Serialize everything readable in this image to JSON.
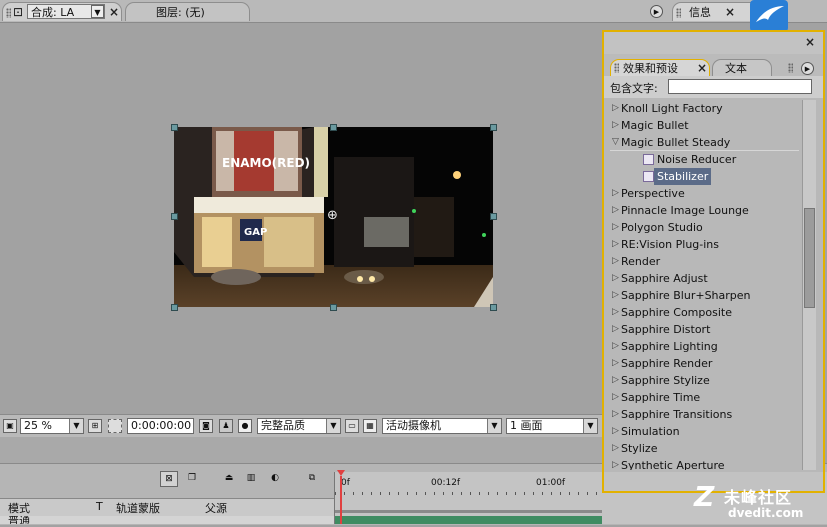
{
  "top_tabs": {
    "comp_tab_label": "合成: LA",
    "layer_tab_label": "图层: (无)",
    "info_tab_label": "信息",
    "close_glyph": "×"
  },
  "comp_timecode_partial": "0:00:00:00",
  "viewer_toolbar": {
    "zoom_value": "25 %",
    "timecode": "0:00:00:00",
    "quality_value": "完整品质",
    "camera_value": "活动摄像机",
    "view_value": "1 画面"
  },
  "timeline": {
    "columns": {
      "mode": "模式",
      "t": "T",
      "track_matte": "轨道蒙版",
      "parent": "父源"
    },
    "row_partial_mode": "普通",
    "ruler_ticks": [
      "0f",
      "00:12f",
      "01:00f"
    ]
  },
  "effects_panel": {
    "tab_effects": "效果和预设",
    "tab_text": "文本",
    "search_label": "包含文字:",
    "search_value": "",
    "items": [
      {
        "label": "Knoll Light Factory",
        "expanded": false,
        "level": 0
      },
      {
        "label": "Magic Bullet",
        "expanded": false,
        "level": 0
      },
      {
        "label": "Magic Bullet Steady",
        "expanded": true,
        "level": 0
      },
      {
        "label": "Noise Reducer",
        "level": 1
      },
      {
        "label": "Stabilizer",
        "level": 1,
        "selected": true
      },
      {
        "label": "Perspective",
        "expanded": false,
        "level": 0
      },
      {
        "label": "Pinnacle Image Lounge",
        "expanded": false,
        "level": 0
      },
      {
        "label": "Polygon Studio",
        "expanded": false,
        "level": 0
      },
      {
        "label": "RE:Vision Plug-ins",
        "expanded": false,
        "level": 0
      },
      {
        "label": "Render",
        "expanded": false,
        "level": 0
      },
      {
        "label": "Sapphire Adjust",
        "expanded": false,
        "level": 0
      },
      {
        "label": "Sapphire Blur+Sharpen",
        "expanded": false,
        "level": 0
      },
      {
        "label": "Sapphire Composite",
        "expanded": false,
        "level": 0
      },
      {
        "label": "Sapphire Distort",
        "expanded": false,
        "level": 0
      },
      {
        "label": "Sapphire Lighting",
        "expanded": false,
        "level": 0
      },
      {
        "label": "Sapphire Render",
        "expanded": false,
        "level": 0
      },
      {
        "label": "Sapphire Stylize",
        "expanded": false,
        "level": 0
      },
      {
        "label": "Sapphire Time",
        "expanded": false,
        "level": 0
      },
      {
        "label": "Sapphire Transitions",
        "expanded": false,
        "level": 0
      },
      {
        "label": "Simulation",
        "expanded": false,
        "level": 0
      },
      {
        "label": "Stylize",
        "expanded": false,
        "level": 0
      },
      {
        "label": "Synthetic Aperture",
        "expanded": false,
        "level": 0
      }
    ]
  },
  "comp_image_text": {
    "billboard": "ENAMO(RED)",
    "store_sign": "GAP"
  },
  "watermark": {
    "brand": "未峰社区",
    "url": "dvedit.com"
  },
  "colors": {
    "panel_highlight": "#e2b100",
    "selection": "#5b6b88",
    "workspace_bg": "#a2a2a2"
  }
}
